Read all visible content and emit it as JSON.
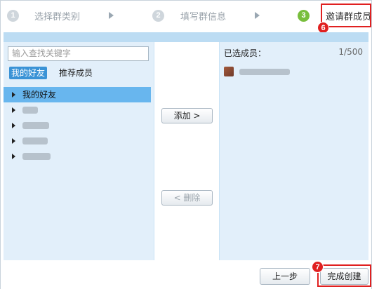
{
  "steps": [
    {
      "num": "1",
      "label": "选择群类别",
      "state": "done"
    },
    {
      "num": "2",
      "label": "填写群信息",
      "state": "done"
    },
    {
      "num": "3",
      "label": "邀请群成员",
      "state": "active"
    }
  ],
  "markers": {
    "step3": "6",
    "finish": "7"
  },
  "search": {
    "placeholder": "输入查找关键字"
  },
  "tabs": {
    "friends": "我的好友",
    "recommend": "推荐成员"
  },
  "tree": {
    "selected_group": "我的好友",
    "blurred_groups": 4
  },
  "actions": {
    "add": "添加 >",
    "remove": "< 删除"
  },
  "selected": {
    "label": "已选成员：",
    "count": "1/500"
  },
  "footer": {
    "prev": "上一步",
    "finish": "完成创建"
  },
  "colors": {
    "accent": "#3a93d6",
    "step_active": "#78be3c",
    "highlight": "#e02020",
    "panel": "#e2effa"
  }
}
